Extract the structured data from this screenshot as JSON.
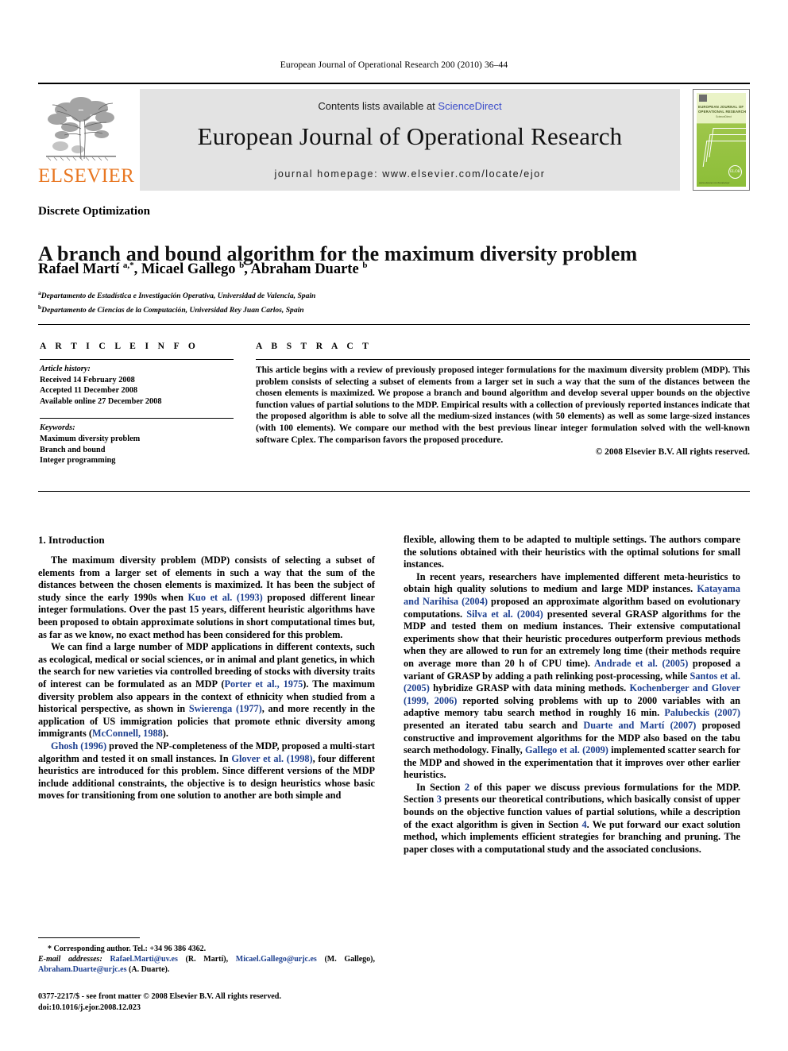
{
  "running_head": "European Journal of Operational Research 200 (2010) 36–44",
  "masthead": {
    "publisher_wordmark": "ELSEVIER",
    "contents_prefix": "Contents lists available at ",
    "contents_link": "ScienceDirect",
    "journal_title": "European Journal of Operational Research",
    "homepage_line": "journal homepage: www.elsevier.com/locate/ejor",
    "cover": {
      "line1": "EUROPEAN JOURNAL OF",
      "line2": "OPERATIONAL RESEARCH",
      "sub": "ScienceDirect",
      "url": "www.elsevier.com/locate/ejor",
      "seal": "ELOR"
    },
    "accent_link_color": "#3b4cca",
    "elsevier_orange": "#E87722",
    "banner_gray": "#e3e3e3"
  },
  "section_label": "Discrete Optimization",
  "article_title": "A branch and bound algorithm for the maximum diversity problem",
  "authors_html": "Rafael Martí <sup>a,*</sup>, Micael Gallego <sup>b</sup>, Abraham Duarte <sup>b</sup>",
  "affiliations": [
    {
      "marker": "a",
      "text": "Departamento de Estadística e Investigación Operativa, Universidad de Valencia, Spain"
    },
    {
      "marker": "b",
      "text": "Departamento de Ciencias de la Computación, Universidad Rey Juan Carlos, Spain"
    }
  ],
  "article_info": {
    "heading": "A R T I C L E   I N F O",
    "history_label": "Article history:",
    "history": [
      "Received 14 February 2008",
      "Accepted 11 December 2008",
      "Available online 27 December 2008"
    ],
    "keywords_label": "Keywords:",
    "keywords": [
      "Maximum diversity problem",
      "Branch and bound",
      "Integer programming"
    ]
  },
  "abstract": {
    "heading": "A B S T R A C T",
    "text": "This article begins with a review of previously proposed integer formulations for the maximum diversity problem (MDP). This problem consists of selecting a subset of elements from a larger set in such a way that the sum of the distances between the chosen elements is maximized. We propose a branch and bound algorithm and develop several upper bounds on the objective function values of partial solutions to the MDP. Empirical results with a collection of previously reported instances indicate that the proposed algorithm is able to solve all the medium-sized instances (with 50 elements) as well as some large-sized instances (with 100 elements). We compare our method with the best previous linear integer formulation solved with the well-known software Cplex. The comparison favors the proposed procedure.",
    "copyright": "© 2008 Elsevier B.V. All rights reserved."
  },
  "body": {
    "intro_heading": "1. Introduction",
    "left_paragraphs": [
      {
        "parts": [
          {
            "t": "The maximum diversity problem (MDP) consists of selecting a subset of elements from a larger set of elements in such a way that the sum of the distances between the chosen elements is maximized. It has been the subject of study since the early 1990s when "
          },
          {
            "t": "Kuo et al. (1993)",
            "cite": true
          },
          {
            "t": " proposed different linear integer formulations. Over the past 15 years, different heuristic algorithms have been proposed to obtain approximate solutions in short computational times but, as far as we know, no exact method has been considered for this problem."
          }
        ]
      },
      {
        "parts": [
          {
            "t": "We can find a large number of MDP applications in different contexts, such as ecological, medical or social sciences, or in animal and plant genetics, in which the search for new varieties via controlled breeding of stocks with diversity traits of interest can be formulated as an MDP ("
          },
          {
            "t": "Porter et al., 1975",
            "cite": true
          },
          {
            "t": "). The maximum diversity problem also appears in the context of ethnicity when studied from a historical perspective, as shown in "
          },
          {
            "t": "Swierenga (1977)",
            "cite": true
          },
          {
            "t": ", and more recently in the application of US immigration policies that promote ethnic diversity among immigrants ("
          },
          {
            "t": "McConnell, 1988",
            "cite": true
          },
          {
            "t": ")."
          }
        ]
      },
      {
        "parts": [
          {
            "t": "Ghosh (1996)",
            "cite": true
          },
          {
            "t": " proved the NP-completeness of the MDP, proposed a multi-start algorithm and tested it on small instances. In "
          },
          {
            "t": "Glover et al. (1998)",
            "cite": true
          },
          {
            "t": ", four different heuristics are introduced for this problem. Since different versions of the MDP include additional constraints, the objective is to design heuristics whose basic moves for transitioning from one solution to another are both simple and"
          }
        ]
      }
    ],
    "right_paragraphs": [
      {
        "noindent": true,
        "parts": [
          {
            "t": "flexible, allowing them to be adapted to multiple settings. The authors compare the solutions obtained with their heuristics with the optimal solutions for small instances."
          }
        ]
      },
      {
        "parts": [
          {
            "t": "In recent years, researchers have implemented different meta-heuristics to obtain high quality solutions to medium and large MDP instances. "
          },
          {
            "t": "Katayama and Narihisa (2004)",
            "cite": true
          },
          {
            "t": " proposed an approximate algorithm based on evolutionary computations. "
          },
          {
            "t": "Silva et al. (2004)",
            "cite": true
          },
          {
            "t": " presented several GRASP algorithms for the MDP and tested them on medium instances. Their extensive computational experiments show that their heuristic procedures outperform previous methods when they are allowed to run for an extremely long time (their methods require on average more than 20 h of CPU time). "
          },
          {
            "t": "Andrade et al. (2005)",
            "cite": true
          },
          {
            "t": " proposed a variant of GRASP by adding a path relinking post-processing, while "
          },
          {
            "t": "Santos et al. (2005)",
            "cite": true
          },
          {
            "t": " hybridize GRASP with data mining methods. "
          },
          {
            "t": "Kochenberger and Glover (1999, 2006)",
            "cite": true
          },
          {
            "t": " reported solving problems with up to 2000 variables with an adaptive memory tabu search method in roughly 16 min. "
          },
          {
            "t": "Palubeckis (2007)",
            "cite": true
          },
          {
            "t": " presented an iterated tabu search and "
          },
          {
            "t": "Duarte and Martí (2007)",
            "cite": true
          },
          {
            "t": " proposed constructive and improvement algorithms for the MDP also based on the tabu search methodology. Finally, "
          },
          {
            "t": "Gallego et al. (2009)",
            "cite": true
          },
          {
            "t": " implemented scatter search for the MDP and showed in the experimentation that it improves over other earlier heuristics."
          }
        ]
      },
      {
        "parts": [
          {
            "t": "In Section "
          },
          {
            "t": "2",
            "cite": true
          },
          {
            "t": " of this paper we discuss previous formulations for the MDP. Section "
          },
          {
            "t": "3",
            "cite": true
          },
          {
            "t": " presents our theoretical contributions, which basically consist of upper bounds on the objective function values of partial solutions, while a description of the exact algorithm is given in Section "
          },
          {
            "t": "4",
            "cite": true
          },
          {
            "t": ". We put forward our exact solution method, which implements efficient strategies for branching and pruning. The paper closes with a computational study and the associated conclusions."
          }
        ]
      }
    ]
  },
  "footnotes": {
    "corresponding": "* Corresponding author. Tel.: +34 96 386 4362.",
    "email_label": "E-mail addresses:",
    "emails": [
      {
        "address": "Rafael.Marti@uv.es",
        "who": " (R. Martí), "
      },
      {
        "address": "Micael.Gallego@urjc.es",
        "who": " (M. Gallego), "
      },
      {
        "address": "Abraham.Duarte@urjc.es",
        "who": " (A. Duarte)."
      }
    ]
  },
  "imprint": {
    "line1": "0377-2217/$ - see front matter © 2008 Elsevier B.V. All rights reserved.",
    "line2": "doi:10.1016/j.ejor.2008.12.023"
  }
}
